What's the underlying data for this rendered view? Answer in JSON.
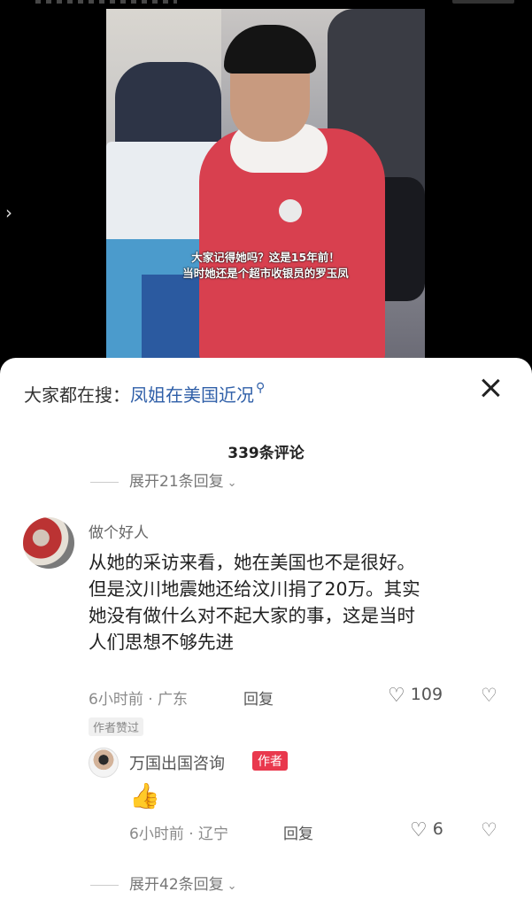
{
  "video": {
    "subtitle_line1": "大家记得她吗？这是15年前！",
    "subtitle_line2": "当时她还是个超市收银员的罗玉凤"
  },
  "search_bar": {
    "prefix": "大家都在搜：",
    "keyword": "凤姐在美国近况"
  },
  "comments_header": {
    "count_label": "339条评论"
  },
  "top_expand": {
    "label": "展开21条回复"
  },
  "comment": {
    "user": "做个好人",
    "text_lines": [
      "从她的采访来看，她在美国也不是很好。",
      "但是汶川地震她还给汶川捐了20万。其实",
      "她没有做什么对不起大家的事，这是当时",
      "人们思想不够先进"
    ],
    "time": "6小时前",
    "location": "广东",
    "reply_label": "回复",
    "likes": "109",
    "liked_tag": "作者赞过"
  },
  "reply": {
    "user": "万国出国咨询",
    "author_tag": "作者",
    "text": "👍",
    "time": "6小时前",
    "location": "辽宁",
    "reply_label": "回复",
    "likes": "6"
  },
  "bottom_expand": {
    "label": "展开42条回复"
  },
  "icons": {
    "search": "search-icon",
    "close": "close-icon",
    "heart": "heart-icon",
    "dislike": "broken-heart-icon",
    "chevron": "chevron-down-icon",
    "back": "chevron-left-icon"
  },
  "colors": {
    "link": "#2f5fa8",
    "author_tag": "#e9384d"
  }
}
